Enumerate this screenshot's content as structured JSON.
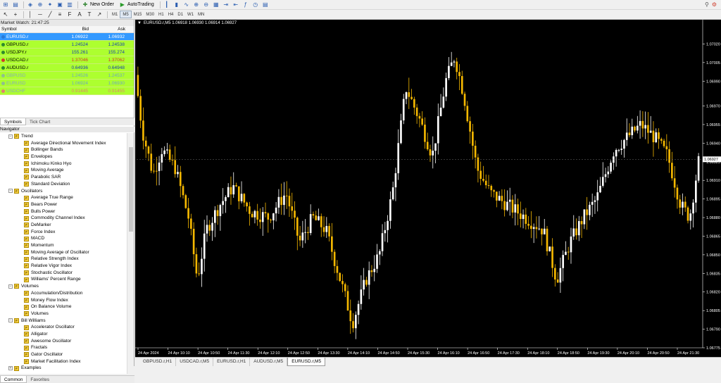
{
  "toolbar": {
    "new_order_label": "New Order",
    "autotrading_label": "AutoTrading",
    "timeframes": [
      "M1",
      "M5",
      "M15",
      "M30",
      "H1",
      "H4",
      "D1",
      "W1",
      "MN"
    ],
    "active_timeframe": "M5"
  },
  "market_watch": {
    "title": "Market Watch: 21:47:25",
    "columns": [
      "Symbol",
      "Bid",
      "Ask"
    ],
    "rows": [
      {
        "symbol": "EURUSD.r",
        "bid": "1.06922",
        "ask": "1.06932",
        "state": "selected",
        "dot": "#2a7ad6"
      },
      {
        "symbol": "GBPUSD.r",
        "bid": "1.24524",
        "ask": "1.24538",
        "state": "up",
        "dot": "#2e8b2e"
      },
      {
        "symbol": "USDJPY.r",
        "bid": "155.261",
        "ask": "155.274",
        "state": "up",
        "dot": "#2e8b2e"
      },
      {
        "symbol": "USDCAD.r",
        "bid": "1.37046",
        "ask": "1.37062",
        "state": "down",
        "dot": "#d43a2a"
      },
      {
        "symbol": "AUDUSD.r",
        "bid": "0.64936",
        "ask": "0.64948",
        "state": "up",
        "dot": "#2e8b2e"
      },
      {
        "symbol": "GBPUSD",
        "bid": "1.24526",
        "ask": "1.24537",
        "state": "dim",
        "dot": "#8fbf8f"
      },
      {
        "symbol": "EURUSD",
        "bid": "1.06924",
        "ask": "1.06930",
        "state": "dim",
        "dot": "#8fbf8f"
      },
      {
        "symbol": "USDCHF",
        "bid": "0.91445",
        "ask": "0.91455",
        "state": "dimdown",
        "dot": "#e08070"
      }
    ],
    "tabs": [
      "Symbols",
      "Tick Chart"
    ]
  },
  "navigator": {
    "title": "Navigator",
    "groups": [
      {
        "name": "Trend",
        "items": [
          "Average Directional Movement Index",
          "Bollinger Bands",
          "Envelopes",
          "Ichimoku Kinko Hyo",
          "Moving Average",
          "Parabolic SAR",
          "Standard Deviation"
        ]
      },
      {
        "name": "Oscillators",
        "items": [
          "Average True Range",
          "Bears Power",
          "Bulls Power",
          "Commodity Channel Index",
          "DeMarker",
          "Force Index",
          "MACD",
          "Momentum",
          "Moving Average of Oscillator",
          "Relative Strength Index",
          "Relative Vigor Index",
          "Stochastic Oscillator",
          "Williams' Percent Range"
        ]
      },
      {
        "name": "Volumes",
        "items": [
          "Accumulation/Distribution",
          "Money Flow Index",
          "On Balance Volume",
          "Volumes"
        ]
      },
      {
        "name": "Bill Williams",
        "items": [
          "Accelerator Oscillator",
          "Alligator",
          "Awesome Oscillator",
          "Fractals",
          "Gator Oscillator",
          "Market Facilitation Index"
        ]
      },
      {
        "name": "Examples",
        "items": []
      }
    ],
    "tabs": [
      "Common",
      "Favorites"
    ]
  },
  "chart": {
    "header": "EURUSD.r,M5  1.06918 1.06930 1.06914 1.06927",
    "current_price_label": "1.06927",
    "colors": {
      "background": "#000000",
      "bull": "#ffffff",
      "bear": "#f5b800",
      "axis": "#ffffff"
    }
  },
  "chart_data": {
    "type": "candlestick",
    "symbol": "EURUSD.r",
    "timeframe": "M5",
    "ylim": [
      1.06775,
      1.07035
    ],
    "y_ticks": [
      "1.07020",
      "1.07005",
      "1.06990",
      "1.06970",
      "1.06955",
      "1.06940",
      "1.06925",
      "1.06910",
      "1.06895",
      "1.06880",
      "1.06865",
      "1.06850",
      "1.06835",
      "1.06820",
      "1.06805",
      "1.06790",
      "1.06775"
    ],
    "x_ticks": [
      "24 Apr 2024",
      "24 Apr 10:10",
      "24 Apr 10:50",
      "24 Apr 11:30",
      "24 Apr 12:10",
      "24 Apr 12:50",
      "24 Apr 13:30",
      "24 Apr 14:10",
      "24 Apr 14:50",
      "24 Apr 15:30",
      "24 Apr 16:10",
      "24 Apr 16:50",
      "24 Apr 17:30",
      "24 Apr 18:10",
      "24 Apr 18:50",
      "24 Apr 19:30",
      "24 Apr 20:10",
      "24 Apr 20:50",
      "24 Apr 21:30"
    ],
    "last_price": 1.06927
  },
  "chart_tabs": [
    "GBPUSD.r,H1",
    "USDCAD.r,M5",
    "EURUSD.r,H1",
    "AUDUSD.r,M5",
    "EURUSD.r,M5"
  ],
  "active_chart_tab": "EURUSD.r,M5"
}
